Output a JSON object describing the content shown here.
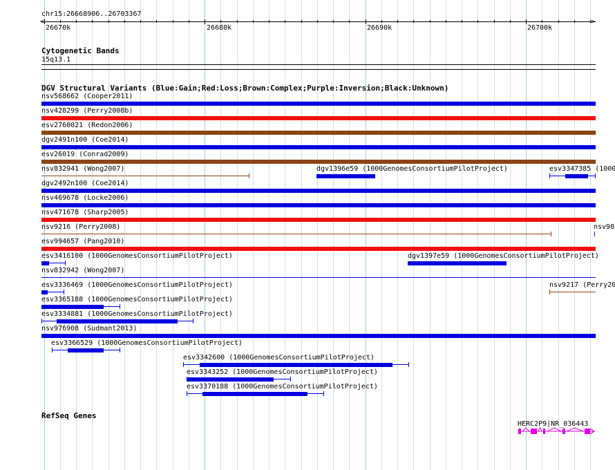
{
  "ruler": {
    "locus": "chr15:26668906..26703367",
    "tick_labels": [
      "26670k",
      "26680k",
      "26690k",
      "26700k"
    ]
  },
  "tracks": {
    "cyto": {
      "title": "Cytogenetic Bands",
      "band": "15q13.1"
    },
    "dgv": {
      "title": "DGV Structural Variants (Blue:Gain;Red:Loss;Brown:Complex;Purple:Inversion;Black:Unknown)",
      "features": [
        {
          "label": "nsv568662 (Cooper2011)",
          "color": "#0000e0"
        },
        {
          "label": "nsv428299 (Perry2008b)",
          "color": "#f01010"
        },
        {
          "label": "esv2760021 (Redon2006)",
          "color": "#8b4513"
        },
        {
          "label": "dgv2491n100 (Coe2014)",
          "color": "#0000e0"
        },
        {
          "label": "esv26019 (Conrad2009)",
          "color": "#8b4513"
        },
        {
          "label": "nsv832941 (Wong2007)",
          "color": "#8b4513"
        },
        {
          "label": "dgv1396e59 (1000GenomesConsortiumPilotProject)",
          "color": "#0000e0"
        },
        {
          "label": "esv3347385 (1000",
          "color": "#0000e0"
        },
        {
          "label": "dgv2492n100 (Coe2014)",
          "color": "#0000e0"
        },
        {
          "label": "nsv469678 (Locke2006)",
          "color": "#0000e0"
        },
        {
          "label": "nsv471678 (Sharp2005)",
          "color": "#f01010"
        },
        {
          "label": "nsv9216 (Perry2008)",
          "color": "#8b4513"
        },
        {
          "label": "nsv98",
          "color": "#0000e0"
        },
        {
          "label": "esv994657 (Pang2010)",
          "color": "#f01010"
        },
        {
          "label": "esv3416100 (1000GenomesConsortiumPilotProject)",
          "color": "#0000e0"
        },
        {
          "label": "dgv1397e59 (1000GenomesConsortiumPilotProject)",
          "color": "#0000e0"
        },
        {
          "label": "nsv832942 (Wong2007)",
          "color": "#0000e0"
        },
        {
          "label": "esv3336469 (1000GenomesConsortiumPilotProject)",
          "color": "#0000e0"
        },
        {
          "label": "nsv9217 (Perry20",
          "color": "#8b4513"
        },
        {
          "label": "esv3365188 (1000GenomesConsortiumPilotProject)",
          "color": "#0000e0"
        },
        {
          "label": "esv3334881 (1000GenomesConsortiumPilotProject)",
          "color": "#0000e0"
        },
        {
          "label": "nsv976908 (Sudmant2013)",
          "color": "#0000e0"
        },
        {
          "label": "esv3366529 (1000GenomesConsortiumPilotProject)",
          "color": "#0000e0"
        },
        {
          "label": "esv3342600 (1000GenomesConsortiumPilotProject)",
          "color": "#0000e0"
        },
        {
          "label": "esv3343252 (1000GenomesConsortiumPilotProject)",
          "color": "#0000e0"
        },
        {
          "label": "esv3370188 (1000GenomesConsortiumPilotProject)",
          "color": "#0000e0"
        }
      ]
    },
    "refseq": {
      "title": "RefSeq Genes",
      "gene_label": "HERC2P9|NR_036443",
      "gene_color": "#e000e0"
    }
  }
}
